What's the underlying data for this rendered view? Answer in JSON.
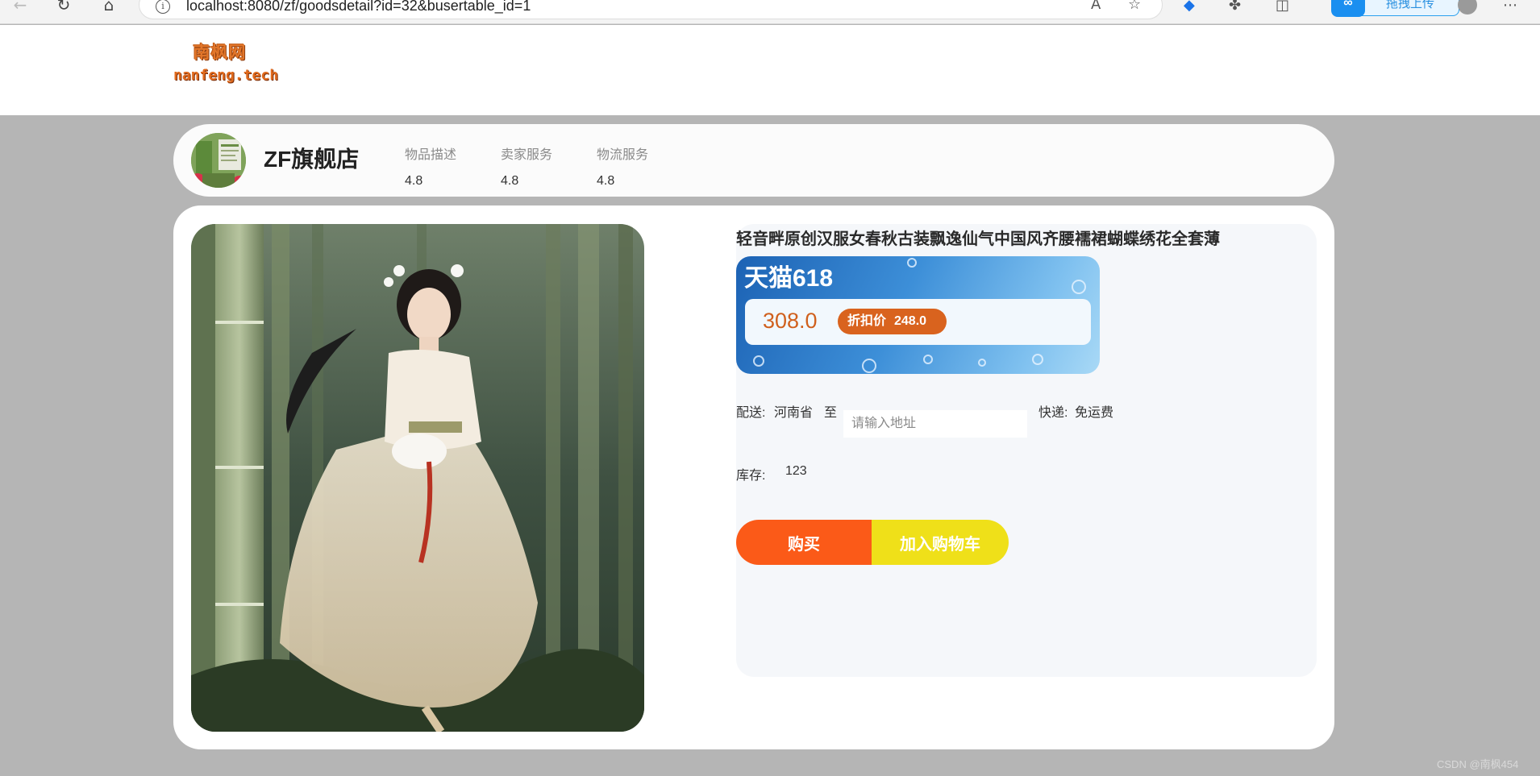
{
  "browser": {
    "url": "localhost:8080/zf/goodsdetail?id=32&busertable_id=1",
    "upload_label": "拖拽上传",
    "icons": [
      "back-icon",
      "refresh-icon",
      "home-icon",
      "info-icon",
      "read-aloud-icon",
      "favorite-icon",
      "extension-icon",
      "split-screen-icon",
      "more-icon"
    ]
  },
  "header": {
    "logo_line1": "南枫网",
    "logo_line2": "nanfeng.tech"
  },
  "shop": {
    "name": "ZF旗舰店",
    "ratings": [
      {
        "label": "物品描述",
        "value": "4.8"
      },
      {
        "label": "卖家服务",
        "value": "4.8"
      },
      {
        "label": "物流服务",
        "value": "4.8"
      }
    ]
  },
  "product": {
    "title": "轻音畔原创汉服女春秋古装飘逸仙气中国风齐腰襦裙蝴蝶绣花全套薄",
    "promo_title": "天猫618",
    "original_price": "308.0",
    "discount_label": "折扣价",
    "discount_price": "248.0",
    "shipping_label": "配送:",
    "shipping_from": "河南省",
    "shipping_to": "至",
    "address_placeholder": "请输入地址",
    "express_label": "快递:",
    "express_value": "免运费",
    "stock_label": "库存:",
    "stock_value": "123",
    "buy_label": "购买",
    "cart_label": "加入购物车"
  },
  "colors": {
    "page_bg": "#b5b5b5",
    "buy_button": "#fb5a18",
    "cart_button": "#efe019",
    "price": "#d0601d",
    "promo_blue": "#3d8fd8"
  },
  "watermark": "CSDN @南枫454"
}
